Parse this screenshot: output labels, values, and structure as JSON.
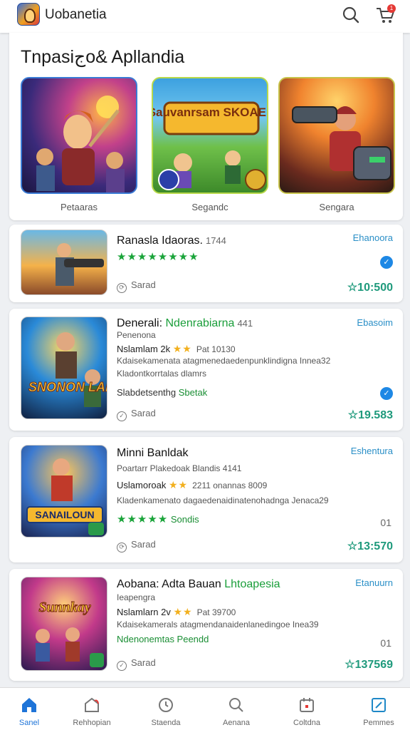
{
  "header": {
    "app_name": "Uobanetia",
    "cart_count": "1"
  },
  "featured": {
    "title": "Tnpasiجo& Apllandia",
    "tiles": [
      {
        "caption": "Petaaras",
        "overlay_text": ""
      },
      {
        "caption": "Segandc",
        "overlay_text": "Sauvanrsam SKOAER"
      },
      {
        "caption": "Sengara",
        "overlay_text": ""
      }
    ]
  },
  "cards": [
    {
      "title": "Ranasla Idaoras.",
      "title_num": "1744",
      "stars": "★★★★★★★★",
      "save": "Sarad",
      "action": "Ehanoora",
      "price": "☆10:500"
    },
    {
      "title": "Denerali:",
      "title_highlight": "Ndenrabiarna",
      "title_num": "441",
      "subtitle": "Penenona",
      "line": "Nslamlam 2k",
      "line_stars": "★★",
      "line_meta": "Pat 10130",
      "desc": "Kdaisekamenata atagmenedaedenpunklindigna Innea32",
      "desc2": "Kladontkorrtalas dlamrs",
      "green_dark": "Slabdetsenthg",
      "green": "Sbetak",
      "save": "Sarad",
      "action": "Ebasoim",
      "price": "☆19.583",
      "thumb_text": "SNONON LADUES"
    },
    {
      "title": "Minni Banldak",
      "subtitle": "Poartarr Plakedoak Blandis",
      "subtitle_num": "4141",
      "line": "Uslamoroak",
      "line_stars": "★★",
      "line_meta": "2211 onannas 8009",
      "desc": "Kladenkamenato dagaedenaidinatenohadnga Jenaca29",
      "stars": "★★★★★",
      "green": "Sondis",
      "save": "Sarad",
      "action": "Eshentura",
      "number": "01",
      "price": "☆13:570",
      "thumb_text": "SANAILOUN"
    },
    {
      "title": "Aobana: Adta Bauan",
      "title_highlight": "Lhtoapesia",
      "subtitle": "Ieapengra",
      "line": "Nslamlarn 2v",
      "line_stars": "★★",
      "line_meta": "Pat 39700",
      "desc": "Kdaisekamerals atagmendanaidenlanedingoe Inea39",
      "green": "Ndenonemtas Peendd",
      "save": "Sarad",
      "action": "Etanuurn",
      "number": "01",
      "price": "☆137569",
      "thumb_text": "Sunnkay"
    }
  ],
  "bottom_nav": [
    {
      "label": "Sanel",
      "icon": "home-icon"
    },
    {
      "label": "Rehhopian",
      "icon": "store-icon"
    },
    {
      "label": "Staenda",
      "icon": "clock-icon"
    },
    {
      "label": "Aenana",
      "icon": "search-icon"
    },
    {
      "label": "Coltdna",
      "icon": "calendar-icon"
    },
    {
      "label": "Pemmes",
      "icon": "edit-icon"
    }
  ]
}
